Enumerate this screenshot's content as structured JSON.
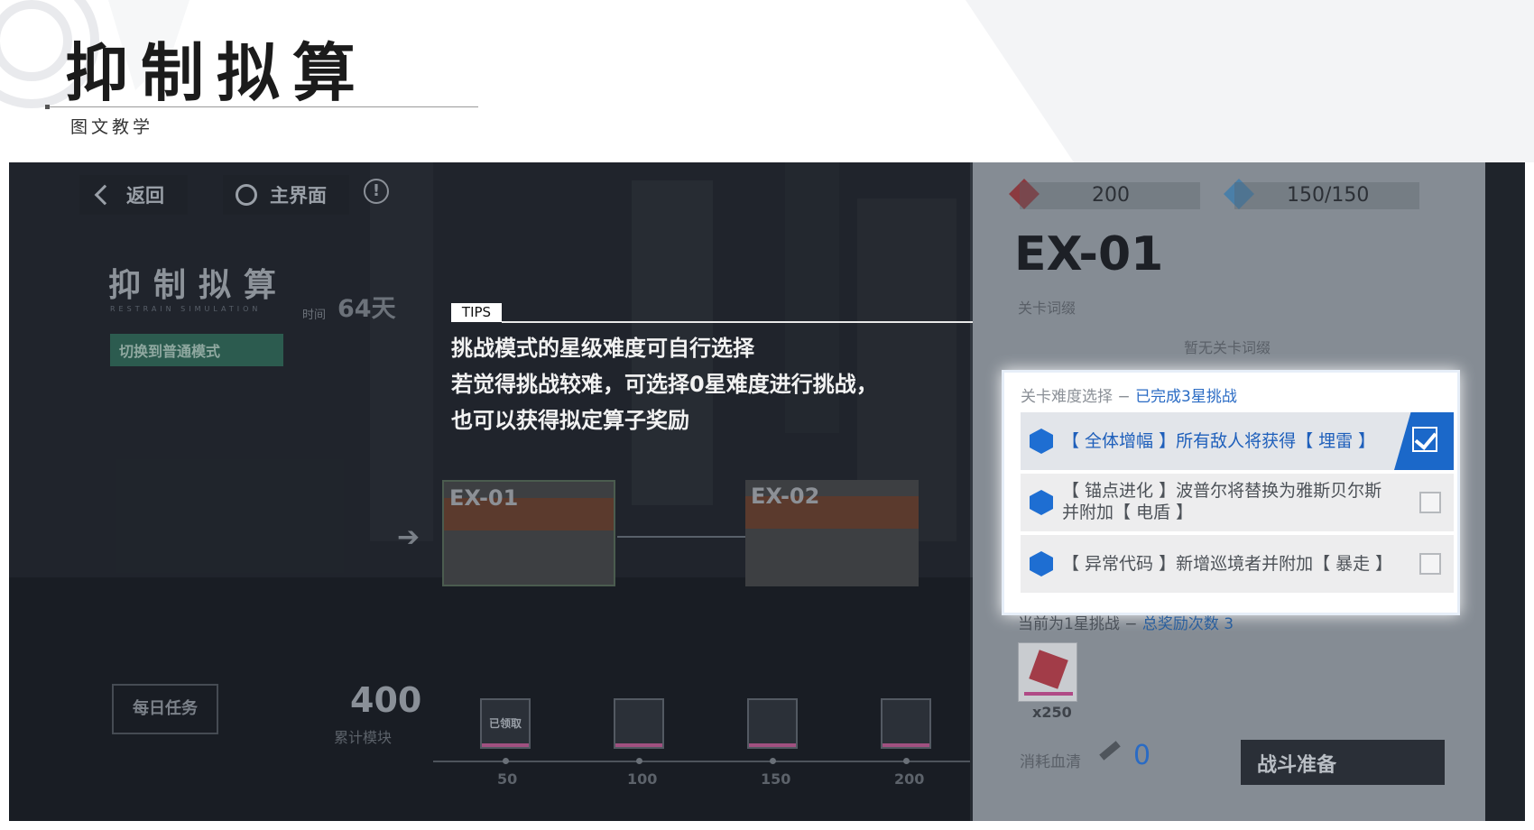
{
  "header": {
    "title": "抑制拟算",
    "subtitle": "图文教学"
  },
  "game": {
    "nav": {
      "back_label": "返回",
      "home_label": "主界面",
      "info_icon": "!"
    },
    "mode_title": "抑制拟算",
    "mode_title_en": "RESTRAIN SIMULATION",
    "time_label": "时间",
    "time_value": "64天",
    "switch_mode_label": "切换到普通模式",
    "stages": [
      {
        "name": "EX-01"
      },
      {
        "name": "EX-02"
      }
    ],
    "daily_task_label": "每日任务",
    "score_value": "400",
    "score_label": "累计模块",
    "rewards": [
      {
        "label": "已领取",
        "tick": "50"
      },
      {
        "label": "",
        "tick": "100"
      },
      {
        "label": "",
        "tick": "150"
      },
      {
        "label": "",
        "tick": "200"
      }
    ]
  },
  "tips": {
    "tag": "TIPS",
    "lines": [
      "挑战模式的星级难度可自行选择",
      "若觉得挑战较难，可选择0星难度进行挑战，",
      "也可以获得拟定算子奖励"
    ]
  },
  "panel": {
    "resource1": "200",
    "resource2": "150/150",
    "stage_title": "EX-01",
    "affix_label": "关卡词缀",
    "no_affix": "暂无关卡词缀",
    "difficulty_label": "关卡难度选择",
    "difficulty_sep": " − ",
    "difficulty_done": "已完成3星挑战",
    "options": [
      {
        "text": "【 全体增幅 】所有敌人将获得【 埋雷 】",
        "selected": true
      },
      {
        "text": "【 锚点进化 】波普尔将替换为雅斯贝尔斯并附加【 电盾 】",
        "selected": false
      },
      {
        "text": "【 异常代码 】新增巡境者并附加【 暴走 】",
        "selected": false
      }
    ],
    "current_challenge": "当前为1星挑战",
    "reward_count_label": "总奖励次数 3",
    "item_count": "x250",
    "cost_label": "消耗血清",
    "cost_value": "0",
    "start_label": "战斗准备"
  },
  "colors": {
    "accent_blue": "#1b68c9",
    "switch_green": "#2c5b4f"
  }
}
